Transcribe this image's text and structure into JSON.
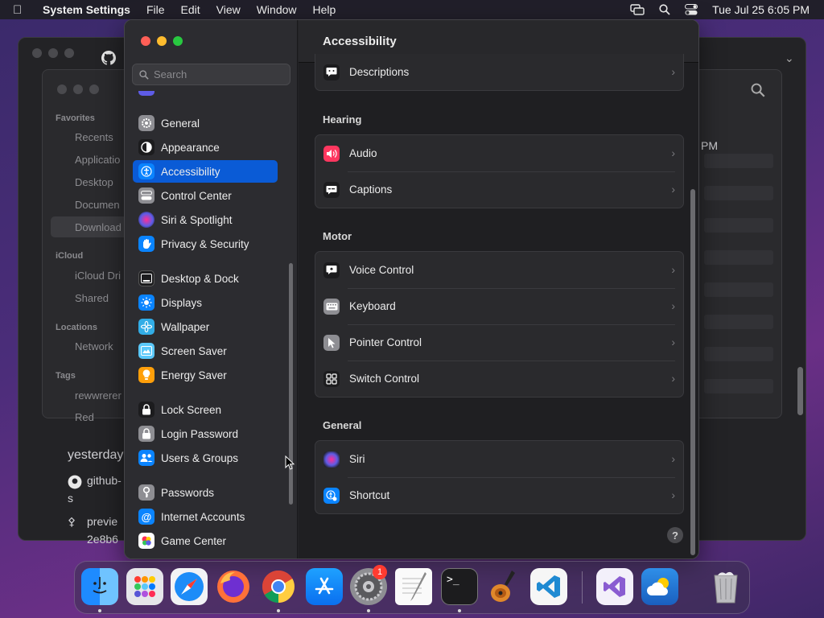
{
  "menubar": {
    "app_name": "System Settings",
    "menus": [
      "File",
      "Edit",
      "View",
      "Window",
      "Help"
    ],
    "clock": "Tue Jul 25  6:05 PM"
  },
  "background": {
    "finder": {
      "favorites_header": "Favorites",
      "favorites": [
        "Recents",
        "Applicatio",
        "Desktop",
        "Documen",
        "Download"
      ],
      "icloud_header": "iCloud",
      "icloud": [
        "iCloud Dri",
        "Shared"
      ],
      "locations_header": "Locations",
      "locations": [
        "Network"
      ],
      "tags_header": "Tags",
      "tags": [
        "rewwrerer",
        "Red"
      ],
      "time_fragment": "PM"
    },
    "github": {
      "heading": "yesterday",
      "line1": "github-",
      "line2": "s",
      "line3": "previe",
      "line4": "2e8b6"
    }
  },
  "sidebar": {
    "search_placeholder": "Search",
    "items": [
      {
        "label": "General",
        "icon": "gear-icon",
        "color": "#8e8e93"
      },
      {
        "label": "Appearance",
        "icon": "appearance-icon",
        "color": "#1c1c1e"
      },
      {
        "label": "Accessibility",
        "icon": "accessibility-icon",
        "color": "#0a84ff"
      },
      {
        "label": "Control Center",
        "icon": "control-center-icon",
        "color": "#8e8e93"
      },
      {
        "label": "Siri & Spotlight",
        "icon": "siri-icon",
        "color": "#5e5ce6"
      },
      {
        "label": "Privacy & Security",
        "icon": "hand-icon",
        "color": "#0a84ff"
      },
      {
        "label": "Desktop & Dock",
        "icon": "dock-icon",
        "color": "#1c1c1e"
      },
      {
        "label": "Displays",
        "icon": "sun-icon",
        "color": "#0a84ff"
      },
      {
        "label": "Wallpaper",
        "icon": "flower-icon",
        "color": "#32ade6"
      },
      {
        "label": "Screen Saver",
        "icon": "screen-saver-icon",
        "color": "#5ac8fa"
      },
      {
        "label": "Energy Saver",
        "icon": "lightbulb-icon",
        "color": "#ff9f0a"
      },
      {
        "label": "Lock Screen",
        "icon": "lock-icon",
        "color": "#1c1c1e"
      },
      {
        "label": "Login Password",
        "icon": "lock-icon",
        "color": "#8e8e93"
      },
      {
        "label": "Users & Groups",
        "icon": "users-icon",
        "color": "#0a84ff"
      },
      {
        "label": "Passwords",
        "icon": "key-icon",
        "color": "#8e8e93"
      },
      {
        "label": "Internet Accounts",
        "icon": "at-icon",
        "color": "#0a84ff"
      },
      {
        "label": "Game Center",
        "icon": "game-center-icon",
        "color": "#ffffff"
      }
    ]
  },
  "content": {
    "title": "Accessibility",
    "top_row": {
      "label": "Descriptions",
      "icon": "descriptions-icon"
    },
    "sections": [
      {
        "title": "Hearing",
        "rows": [
          {
            "label": "Audio",
            "icon": "speaker-icon",
            "color": "#ff375f"
          },
          {
            "label": "Captions",
            "icon": "captions-icon",
            "color": "#1c1c1e"
          }
        ]
      },
      {
        "title": "Motor",
        "rows": [
          {
            "label": "Voice Control",
            "icon": "voice-control-icon",
            "color": "#1c1c1e"
          },
          {
            "label": "Keyboard",
            "icon": "keyboard-icon",
            "color": "#8e8e93"
          },
          {
            "label": "Pointer Control",
            "icon": "pointer-icon",
            "color": "#8e8e93"
          },
          {
            "label": "Switch Control",
            "icon": "switch-control-icon",
            "color": "#1c1c1e"
          }
        ]
      },
      {
        "title": "General",
        "rows": [
          {
            "label": "Siri",
            "icon": "siri-icon",
            "color": "#1c1c1e"
          },
          {
            "label": "Shortcut",
            "icon": "shortcut-icon",
            "color": "#0a84ff"
          }
        ]
      }
    ],
    "help_label": "?"
  },
  "dock": {
    "apps": [
      "finder-icon",
      "launchpad-icon",
      "safari-icon",
      "firefox-icon",
      "chrome-icon",
      "app-store-icon",
      "system-settings-icon",
      "textedit-icon",
      "terminal-icon",
      "garageband-icon",
      "vscode-icon",
      "visual-studio-icon",
      "weather-icon",
      "trash-icon"
    ],
    "settings_badge": "1"
  }
}
